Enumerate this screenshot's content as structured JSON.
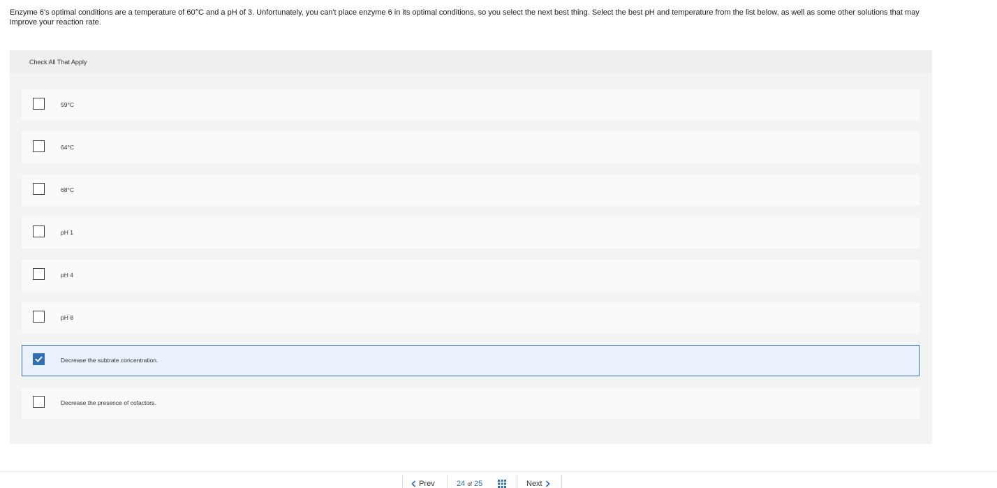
{
  "question": {
    "text": "Enzyme 6's optimal conditions are a temperature of 60°C and a pH of 3. Unfortunately, you can't place enzyme 6 in its optimal conditions, so you select the next best thing. Select the best pH and temperature from the list below, as well as some other solutions that may improve your reaction rate."
  },
  "panel": {
    "instruction": "Check All That Apply"
  },
  "options": [
    {
      "label": "59°C",
      "checked": false
    },
    {
      "label": "64°C",
      "checked": false
    },
    {
      "label": "68°C",
      "checked": false
    },
    {
      "label": "pH 1",
      "checked": false
    },
    {
      "label": "pH 4",
      "checked": false
    },
    {
      "label": "pH 8",
      "checked": false
    },
    {
      "label": "Decrease the subtrate concentration.",
      "checked": true
    },
    {
      "label": "Decrease the presence of cofactors.",
      "checked": false
    }
  ],
  "nav": {
    "prev_label": "Prev",
    "current_page": "24",
    "of_label": "of",
    "total_pages": "25",
    "next_label": "Next"
  },
  "colors": {
    "accent": "#2f6fb2",
    "selected_bg": "#e9f2fb",
    "panel_bg": "#f3f3f3"
  },
  "icons": {
    "prev": "chevron-left-icon",
    "next": "chevron-right-icon",
    "grid": "grid-icon",
    "check": "checkmark-icon"
  }
}
